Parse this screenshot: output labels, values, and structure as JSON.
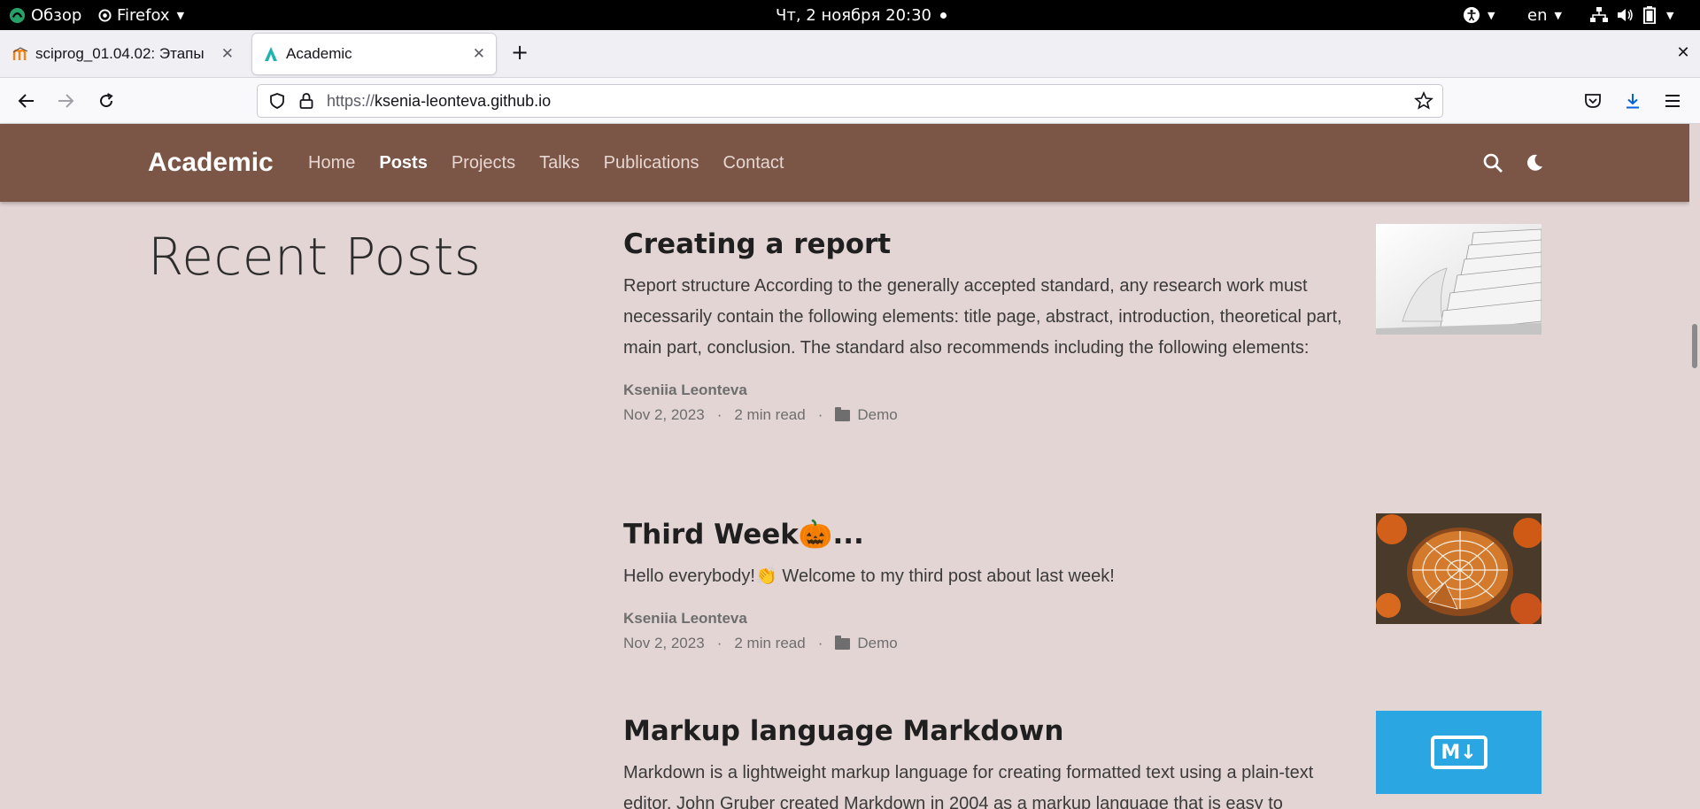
{
  "system_bar": {
    "activities": "Обзор",
    "app_name": "Firefox",
    "clock": "Чт, 2 ноября  20:30",
    "language": "en"
  },
  "browser": {
    "tabs": [
      {
        "title": "sciprog_01.04.02: Этапы",
        "active": false
      },
      {
        "title": "Academic",
        "active": true
      }
    ],
    "url": {
      "protocol": "https://",
      "host": "ksenia-leonteva.github.io"
    }
  },
  "site": {
    "brand": "Academic",
    "menu": [
      {
        "label": "Home",
        "active": false
      },
      {
        "label": "Posts",
        "active": true
      },
      {
        "label": "Projects",
        "active": false
      },
      {
        "label": "Talks",
        "active": false
      },
      {
        "label": "Publications",
        "active": false
      },
      {
        "label": "Contact",
        "active": false
      }
    ],
    "header_color": "#7b5546",
    "page_bg": "#e2d5d4"
  },
  "page": {
    "heading": "Recent Posts"
  },
  "posts": [
    {
      "title": "Creating a report",
      "summary": "Report structure According to the generally accepted standard, any research work must necessarily contain the following elements: title page, abstract, introduction, theoretical part, main part, conclusion. The standard also recommends including the following elements:",
      "author": "Kseniia Leonteva",
      "date": "Nov 2, 2023",
      "read_time": "2 min read",
      "category": "Demo",
      "thumbnail": "papers-stack-image"
    },
    {
      "title": "Third Week🎃...",
      "summary": "Hello everybody!👏 Welcome to my third post about last week!",
      "author": "Kseniia Leonteva",
      "date": "Nov 2, 2023",
      "read_time": "2 min read",
      "category": "Demo",
      "thumbnail": "halloween-pie-image"
    },
    {
      "title": "Markup language Markdown",
      "summary": "Markdown is a lightweight markup language for creating formatted text using a plain-text editor. John Gruber created Markdown in 2004 as a markup language that is easy to",
      "thumbnail": "markdown-logo-image",
      "thumbnail_text": "M↓"
    }
  ]
}
